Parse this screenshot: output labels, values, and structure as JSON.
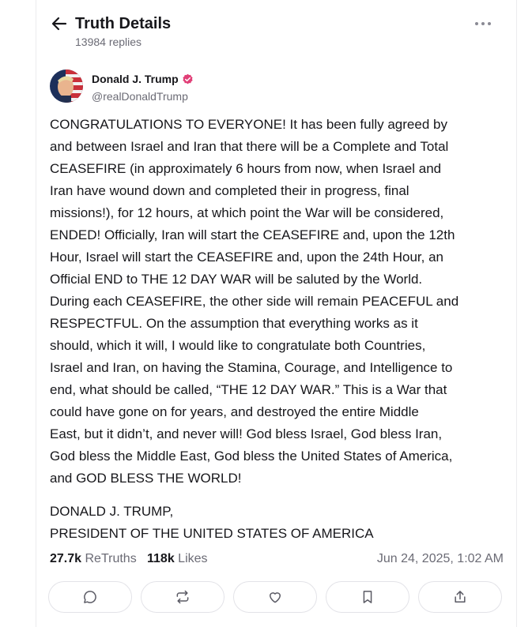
{
  "header": {
    "title": "Truth Details",
    "replies": "13984 replies"
  },
  "author": {
    "name": "Donald J. Trump",
    "handle": "@realDonaldTrump",
    "verified_color": "#e13f77"
  },
  "post": {
    "lines": [
      "CONGRATULATIONS TO EVERYONE! It has been fully agreed by",
      "and between Israel and Iran that there will be a Complete and Total",
      "CEASEFIRE (in approximately 6 hours from now, when Israel and",
      "Iran have wound down and completed their in progress, final",
      "missions!), for 12 hours, at which point the War will be considered,",
      "ENDED! Officially, Iran will start the CEASEFIRE and, upon the 12th",
      "Hour, Israel will start the CEASEFIRE and, upon the 24th Hour, an",
      "Official END to THE 12 DAY WAR will be saluted by the World.",
      "During each CEASEFIRE, the other side will remain PEACEFUL and",
      "RESPECTFUL. On the assumption that everything works as it",
      "should, which it will, I would like to congratulate both Countries,",
      "Israel and Iran, on having the Stamina, Courage, and Intelligence to",
      "end, what should be called, “THE 12 DAY WAR.” This is a War that",
      "could have gone on for years, and destroyed the entire Middle",
      "East, but it didn’t, and never will! God bless Israel, God bless Iran,",
      "God bless the Middle East, God bless the United States of America,",
      "and GOD BLESS THE WORLD!"
    ],
    "signature_line1": "DONALD J. TRUMP,",
    "signature_line2": "PRESIDENT OF THE UNITED STATES OF AMERICA"
  },
  "stats": {
    "retruths_count": "27.7k",
    "retruths_label": "ReTruths",
    "likes_count": "118k",
    "likes_label": "Likes",
    "timestamp": "Jun 24, 2025, 1:02 AM"
  },
  "actions": {
    "icons": [
      "reply-icon",
      "retruth-icon",
      "like-icon",
      "bookmark-icon",
      "share-icon"
    ]
  },
  "colors": {
    "text": "#17171b",
    "muted": "#6b6b75",
    "border": "#e3e3e8"
  }
}
